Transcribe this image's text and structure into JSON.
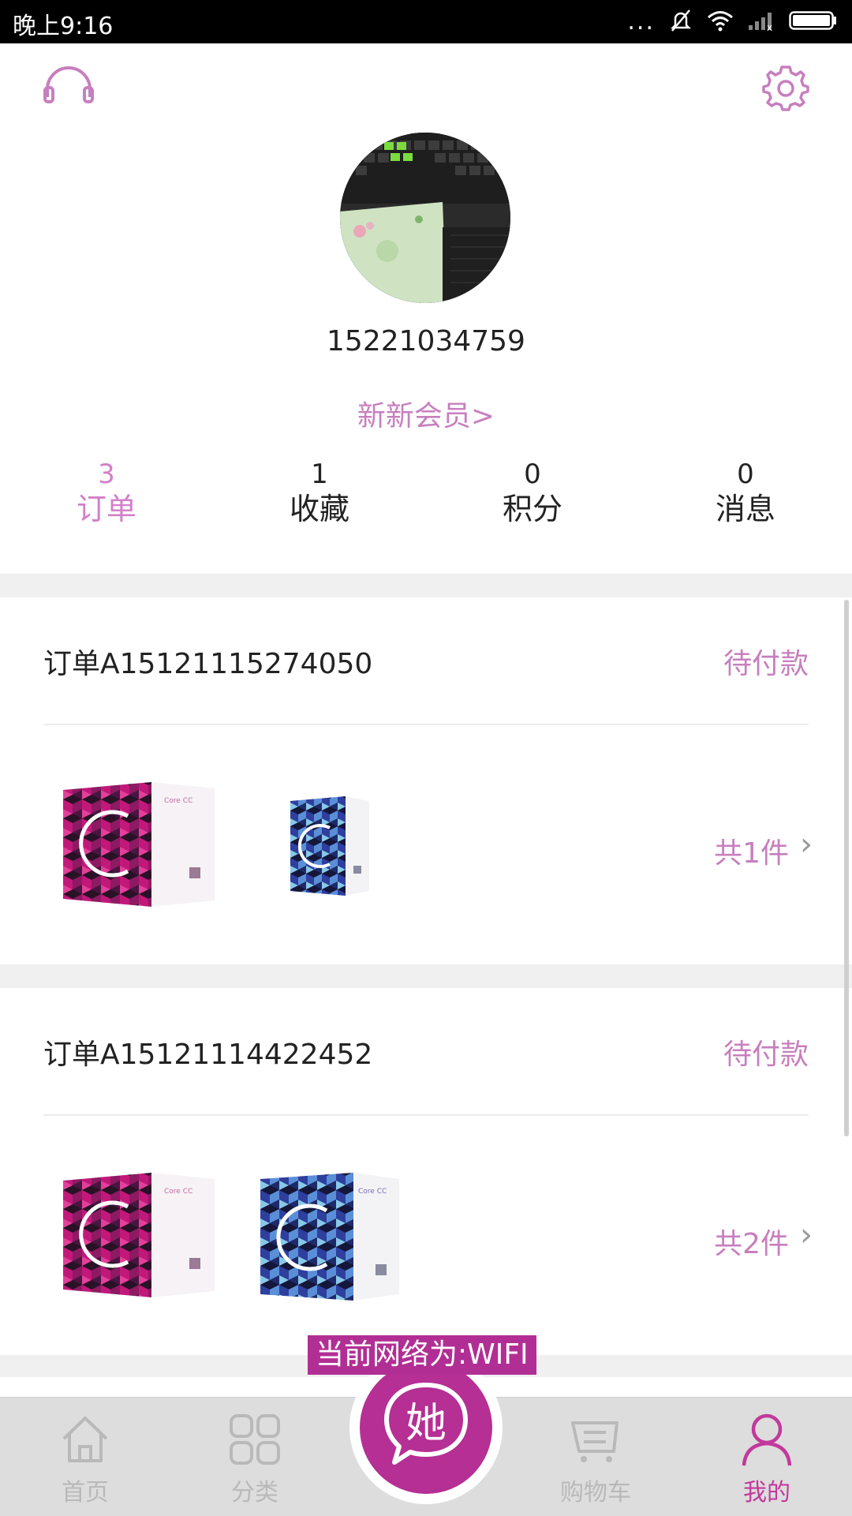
{
  "status_bar": {
    "time": "晚上9:16",
    "dots": "...",
    "battery_level": 1.0
  },
  "profile": {
    "phone": "15221034759",
    "member_link": "新新会员>"
  },
  "stats": [
    {
      "count": "3",
      "label": "订单",
      "active": true
    },
    {
      "count": "1",
      "label": "收藏",
      "active": false
    },
    {
      "count": "0",
      "label": "积分",
      "active": false
    },
    {
      "count": "0",
      "label": "消息",
      "active": false
    }
  ],
  "orders": [
    {
      "id_label": "订单A15121115274050",
      "status": "待付款",
      "item_count": "共1件",
      "products": [
        "pink-box",
        "blue-box"
      ]
    },
    {
      "id_label": "订单A15121114422452",
      "status": "待付款",
      "item_count": "共2件",
      "products": [
        "pink-box",
        "blue-box"
      ]
    }
  ],
  "nav": {
    "home": "首页",
    "category": "分类",
    "center": "她",
    "cart": "购物车",
    "mine": "我的"
  },
  "toast": "当前网络为:WIFI",
  "colors": {
    "accent": "#c77fbe",
    "brand": "#b52f94",
    "nav_inactive": "#b9b9b9"
  }
}
